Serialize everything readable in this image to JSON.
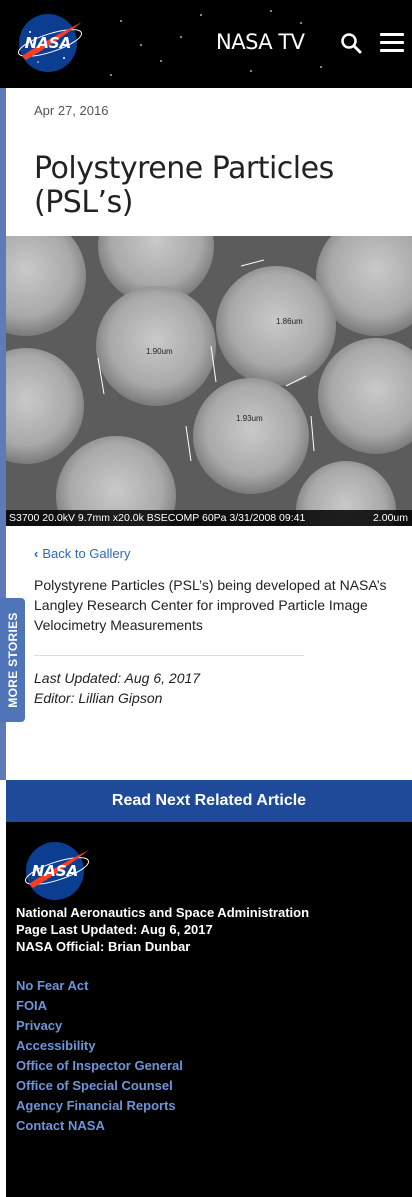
{
  "header": {
    "brand_text": "NASA",
    "nasa_tv": "NASA TV",
    "icons": [
      "nasa-logo",
      "search-icon",
      "menu-icon"
    ]
  },
  "sidebar": {
    "more_stories": "MORE STORIES"
  },
  "article": {
    "date": "Apr 27, 2016",
    "title": "Polystyrene Particles (PSL’s)",
    "image_caption_left": "S3700 20.0kV 9.7mm x20.0k BSECOMP 60Pa 3/31/2008 09:41",
    "image_caption_right": "2.00um",
    "image_labels": [
      "1.86um",
      "1.90um",
      "1.93um"
    ],
    "back_link": "Back to Gallery",
    "description": "Polystyrene Particles (PSL’s) being developed at NASA’s Langley Research Center for improved Particle Image Velocimetry Measurements",
    "last_updated": "Last Updated: Aug 6, 2017",
    "editor": "Editor: Lillian Gipson"
  },
  "read_next": "Read Next Related Article",
  "footer": {
    "agency": "National Aeronautics and Space Administration",
    "page_updated": "Page Last Updated: Aug 6, 2017",
    "official": "NASA Official: Brian Dunbar",
    "links": [
      "No Fear Act",
      "FOIA",
      "Privacy",
      "Accessibility",
      "Office of Inspector General",
      "Office of Special Counsel",
      "Agency Financial Reports",
      "Contact NASA"
    ]
  },
  "colors": {
    "header_bg": "#000000",
    "accent_blue": "#1f4a9a",
    "link_blue": "#2f6ab5",
    "footer_link": "#6f95d6"
  }
}
